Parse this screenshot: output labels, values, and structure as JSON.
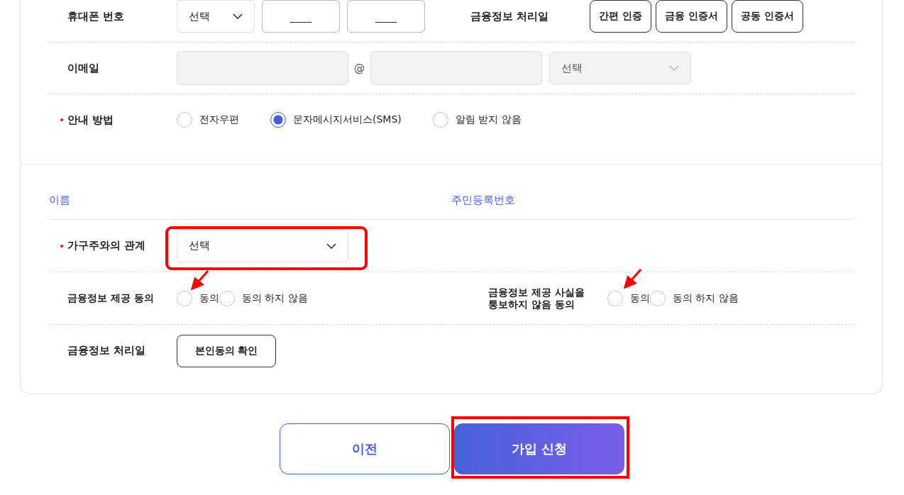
{
  "contact_section": {
    "rows": [
      {
        "kind": "phone",
        "label": "휴대폰 번호",
        "required": false,
        "select": "선택",
        "fields": [
          {
            "placeholder": "____"
          },
          {
            "placeholder": "____"
          }
        ],
        "side_label": "금융정보 처리일",
        "auth_buttons": [
          "간편 인증",
          "금융 인증서",
          "공동 인증서"
        ]
      },
      {
        "kind": "email",
        "label": "이메일",
        "required": false,
        "disabled": true,
        "separator": "@",
        "domain_select": "선택"
      },
      {
        "kind": "radios",
        "label": "안내 방법",
        "required": true,
        "options": [
          {
            "label": "전자우편",
            "selected": false
          },
          {
            "label": "문자메시지서비스(SMS)",
            "selected": true
          },
          {
            "label": "알림 받지 않음",
            "selected": false
          }
        ]
      }
    ]
  },
  "member_section": {
    "name_label": "이름",
    "rrn_label": "주민등록번호",
    "rows": [
      {
        "kind": "select",
        "label": "가구주와의 관계",
        "required": true,
        "select": "선택"
      },
      {
        "kind": "consents",
        "groups": [
          {
            "label": "금융정보 제공 동의",
            "options": [
              {
                "label": "동의",
                "selected": false
              },
              {
                "label": "동의 하지 않음",
                "selected": false
              }
            ]
          },
          {
            "label": "금융정보 제공 사실을 통보하지 않음 동의",
            "options": [
              {
                "label": "동의",
                "selected": false
              },
              {
                "label": "동의 하지 않음",
                "selected": false
              }
            ]
          }
        ]
      },
      {
        "kind": "button",
        "label": "금융정보 처리일",
        "required": false,
        "button": "본인동의 확인"
      }
    ]
  },
  "actions": {
    "previous": "이전",
    "submit": "가입 신청"
  }
}
